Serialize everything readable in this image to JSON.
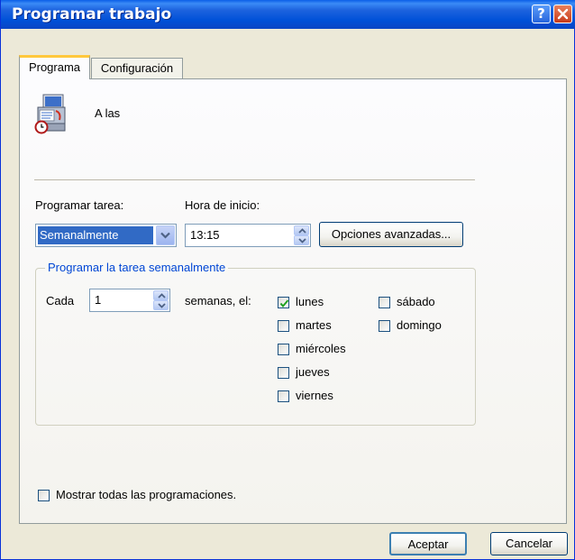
{
  "window": {
    "title": "Programar trabajo",
    "help_label": "?",
    "colors": {
      "titlebar": "#0054e3",
      "face": "#ece9d8",
      "accent": "#316ac5",
      "group_title": "#0046d5"
    }
  },
  "tabs": [
    {
      "label": "Programa",
      "active": true
    },
    {
      "label": "Configuración",
      "active": false
    }
  ],
  "summary": {
    "icon": "scheduled-task-icon",
    "text": "A las"
  },
  "schedule": {
    "task_label": "Programar tarea:",
    "task_value": "Semanalmente",
    "start_label": "Hora de inicio:",
    "start_value": "13:15",
    "advanced_button": "Opciones avanzadas..."
  },
  "weekly": {
    "group_title": "Programar la tarea semanalmente",
    "every_label": "Cada",
    "every_value": "1",
    "weeks_label": "semanas, el:",
    "days": [
      {
        "label": "lunes",
        "checked": true
      },
      {
        "label": "martes",
        "checked": false
      },
      {
        "label": "miércoles",
        "checked": false
      },
      {
        "label": "jueves",
        "checked": false
      },
      {
        "label": "viernes",
        "checked": false
      },
      {
        "label": "sábado",
        "checked": false
      },
      {
        "label": "domingo",
        "checked": false
      }
    ]
  },
  "show_all": {
    "label": "Mostrar todas las programaciones.",
    "checked": false
  },
  "buttons": {
    "ok": "Aceptar",
    "cancel": "Cancelar"
  }
}
